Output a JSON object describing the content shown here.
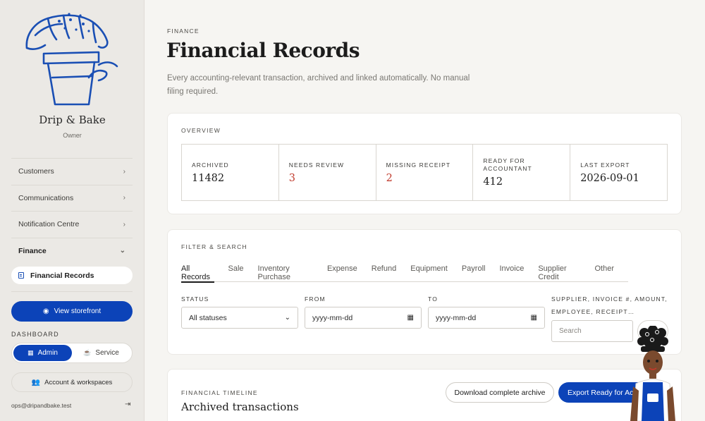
{
  "sidebar": {
    "brand": "Drip & Bake",
    "role": "Owner",
    "nav": [
      {
        "label": "Customers"
      },
      {
        "label": "Communications"
      },
      {
        "label": "Notification Centre"
      },
      {
        "label": "Finance"
      }
    ],
    "sub_item": "Financial Records",
    "storefront_button": "View storefront",
    "dashboard_label": "DASHBOARD",
    "toggle": {
      "admin": "Admin",
      "service": "Service"
    },
    "account_button": "Account & workspaces",
    "email": "ops@dripandbake.test",
    "colors": {
      "accent": "#0c43b8",
      "logo_stroke": "#1a4fb4"
    }
  },
  "header": {
    "eyebrow": "FINANCE",
    "title": "Financial Records",
    "description": "Every accounting-relevant transaction, archived and linked automatically. No manual filing required."
  },
  "overview": {
    "label": "OVERVIEW",
    "stats": [
      {
        "label": "ARCHIVED",
        "value": "11482"
      },
      {
        "label": "NEEDS REVIEW",
        "value": "3"
      },
      {
        "label": "MISSING RECEIPT",
        "value": "2"
      },
      {
        "label": "READY FOR ACCOUNTANT",
        "value": "412"
      },
      {
        "label": "LAST EXPORT",
        "value": "2026-09-01"
      }
    ],
    "alert_color": "#c0392b"
  },
  "filter": {
    "label": "FILTER & SEARCH",
    "tabs": [
      "All Records",
      "Sale",
      "Inventory Purchase",
      "Expense",
      "Refund",
      "Equipment",
      "Payroll",
      "Invoice",
      "Supplier Credit",
      "Other"
    ],
    "status_label": "STATUS",
    "status_value": "All statuses",
    "from_label": "FROM",
    "from_placeholder": "yyyy-mm-dd",
    "to_label": "TO",
    "to_placeholder": "yyyy-mm-dd",
    "search_label": "SUPPLIER, INVOICE #, AMOUNT, EMPLOYEE, RECEIPT…",
    "search_placeholder": "Search"
  },
  "timeline": {
    "label": "FINANCIAL TIMELINE",
    "title": "Archived transactions",
    "download_button": "Download complete archive",
    "export_button": "Export Ready for Accountant"
  }
}
